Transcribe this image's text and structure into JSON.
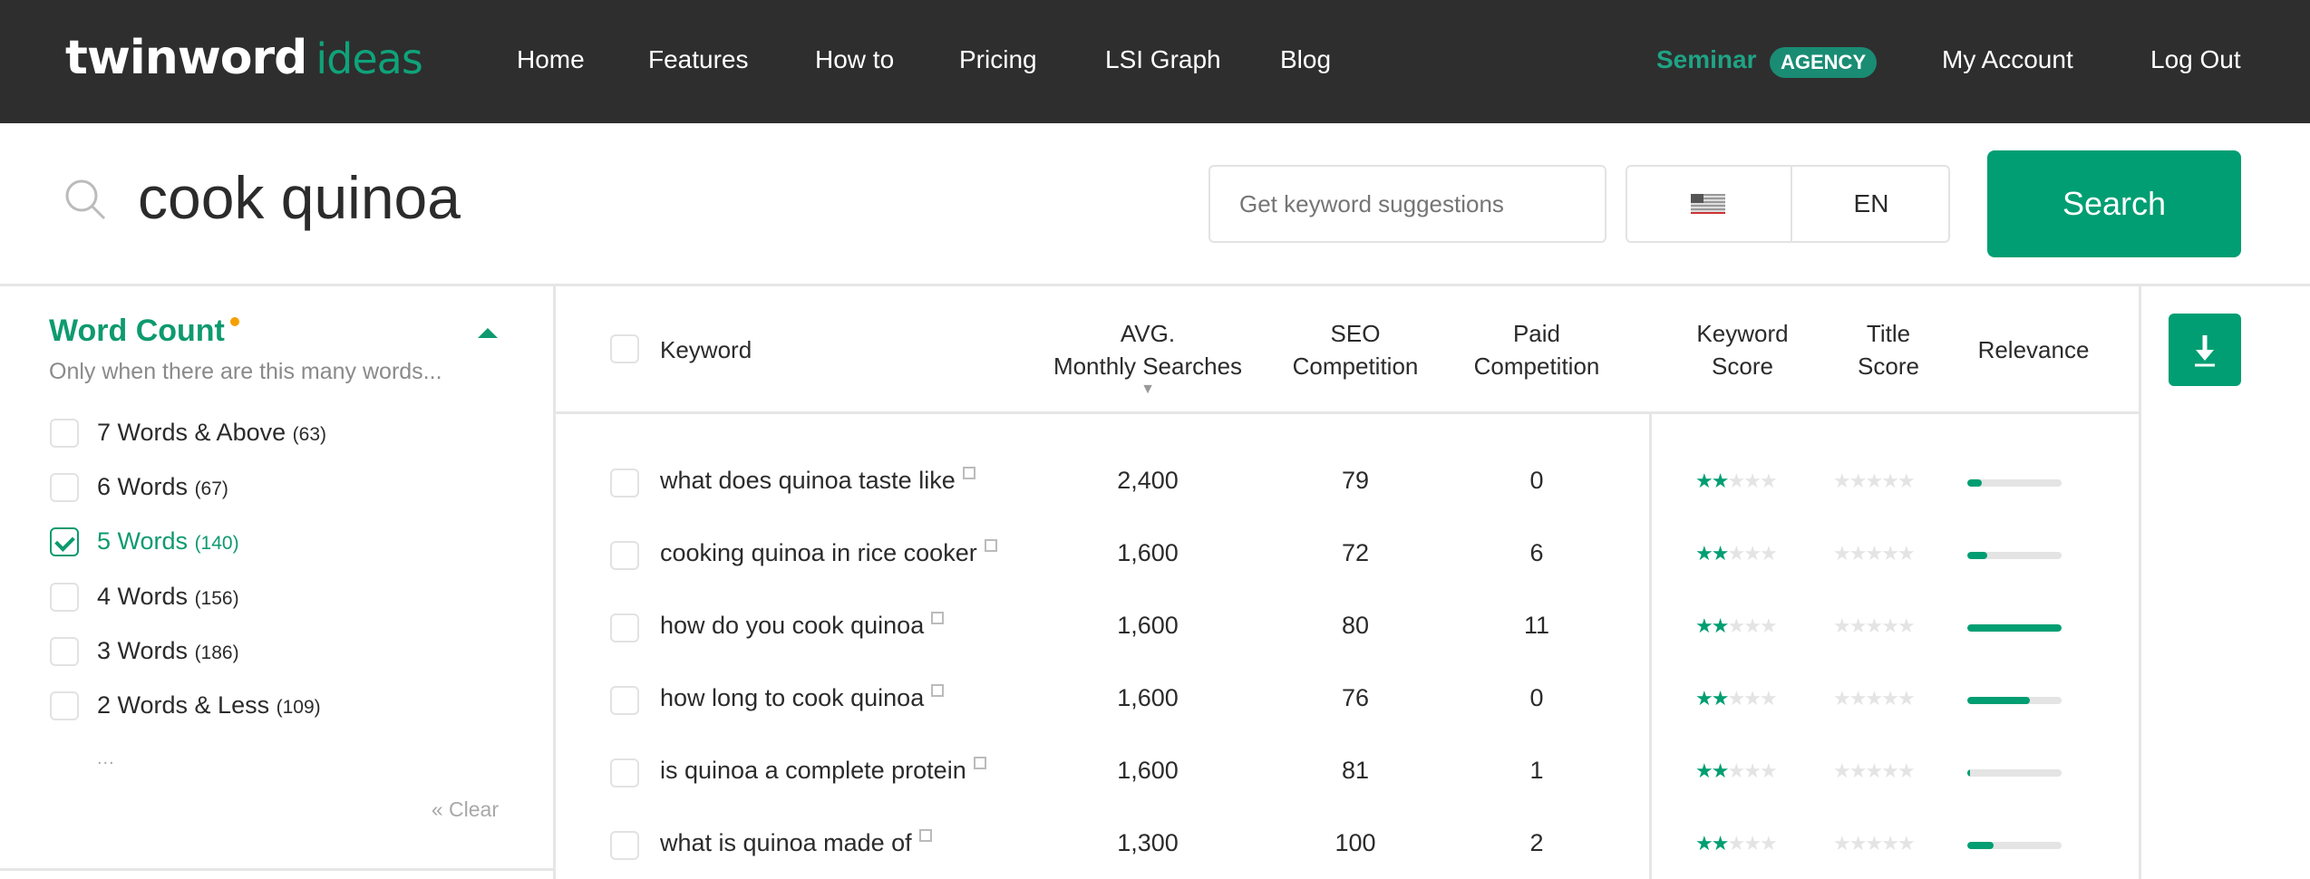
{
  "nav": {
    "logo": {
      "main": "twinword",
      "sub": "ideas"
    },
    "links": [
      "Home",
      "Features",
      "How to",
      "Pricing",
      "LSI Graph",
      "Blog"
    ],
    "seminar": "Seminar",
    "badge": "AGENCY",
    "account": "My Account",
    "logout": "Log Out"
  },
  "search": {
    "query": "cook quinoa",
    "suggest_placeholder": "Get keyword suggestions",
    "country_flag": "us-flag-icon",
    "language": "EN",
    "button": "Search"
  },
  "filter": {
    "title": "Word Count",
    "subtitle": "Only when there are this many words...",
    "items": [
      {
        "label": "7 Words & Above",
        "count": "(63)",
        "checked": false
      },
      {
        "label": "6 Words",
        "count": "(67)",
        "checked": false
      },
      {
        "label": "5 Words",
        "count": "(140)",
        "checked": true
      },
      {
        "label": "4 Words",
        "count": "(156)",
        "checked": false
      },
      {
        "label": "3 Words",
        "count": "(186)",
        "checked": false
      },
      {
        "label": "2 Words & Less",
        "count": "(109)",
        "checked": false
      }
    ],
    "more": "...",
    "clear": "« Clear"
  },
  "table": {
    "headers": {
      "keyword": "Keyword",
      "avg1": "AVG.",
      "avg2": "Monthly Searches",
      "seo1": "SEO",
      "seo2": "Competition",
      "paid1": "Paid",
      "paid2": "Competition",
      "ks1": "Keyword",
      "ks2": "Score",
      "ts1": "Title",
      "ts2": "Score",
      "rel": "Relevance"
    },
    "rows": [
      {
        "keyword": "what does quinoa taste like",
        "searches": "2,400",
        "seo": "79",
        "paid": "0",
        "keyword_score": 2,
        "title_score": 0,
        "relevance_pct": 15
      },
      {
        "keyword": "cooking quinoa in rice cooker",
        "searches": "1,600",
        "seo": "72",
        "paid": "6",
        "keyword_score": 2,
        "title_score": 0,
        "relevance_pct": 21
      },
      {
        "keyword": "how do you cook quinoa",
        "searches": "1,600",
        "seo": "80",
        "paid": "11",
        "keyword_score": 2,
        "title_score": 0,
        "relevance_pct": 100
      },
      {
        "keyword": "how long to cook quinoa",
        "searches": "1,600",
        "seo": "76",
        "paid": "0",
        "keyword_score": 2,
        "title_score": 0,
        "relevance_pct": 66
      },
      {
        "keyword": "is quinoa a complete protein",
        "searches": "1,600",
        "seo": "81",
        "paid": "1",
        "keyword_score": 2,
        "title_score": 0,
        "relevance_pct": 3
      },
      {
        "keyword": "what is quinoa made of",
        "searches": "1,300",
        "seo": "100",
        "paid": "2",
        "keyword_score": 2,
        "title_score": 0,
        "relevance_pct": 28
      }
    ]
  },
  "colors": {
    "brand": "#009e72",
    "nav_bg": "#2e2e2e",
    "star_off": "#e4e4e4"
  }
}
